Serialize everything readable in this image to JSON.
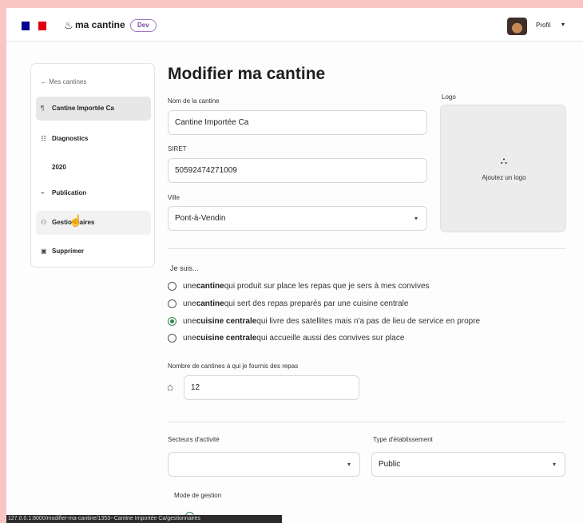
{
  "header": {
    "brand_name": "ma cantine",
    "brand_icon": "chef-hat-icon",
    "env_badge": "Dev",
    "profile_label": "Profil",
    "flag_colors": [
      "#000091",
      "#ffffff",
      "#e1000f"
    ]
  },
  "sidebar": {
    "back_label": "Mes cantines",
    "items": [
      {
        "label": "Cantine Importée Ca",
        "icon": "fork-knife-icon",
        "active": true
      },
      {
        "label": "Diagnostics",
        "icon": "list-icon"
      },
      {
        "label": "2020",
        "icon": ""
      },
      {
        "label": "Publication",
        "icon": "megaphone-icon"
      },
      {
        "label": "Gestionnaires",
        "icon": "team-icon"
      },
      {
        "label": "Supprimer",
        "icon": "trash-icon"
      }
    ]
  },
  "form": {
    "title": "Modifier ma cantine",
    "name_label": "Nom de la cantine",
    "name_value": "Cantine Importée Ca",
    "siret_label": "SIRET",
    "siret_value": "50592474271009",
    "city_label": "Ville",
    "city_value": "Pont-à-Vendin",
    "logo_label": "Logo",
    "logo_cta": "Ajoutez un logo",
    "role_label": "Je suis...",
    "role_options": [
      {
        "prefix": "une ",
        "bold": "cantine",
        "suffix": " qui produit sur place les repas que je sers à mes convives",
        "checked": false
      },
      {
        "prefix": "une ",
        "bold": "cantine",
        "suffix": " qui sert des repas preparés par une cuisine centrale",
        "checked": false
      },
      {
        "prefix": "une ",
        "bold": "cuisine centrale",
        "suffix": " qui livre des satellites mais n'a pas de lieu de service en propre",
        "checked": true
      },
      {
        "prefix": "une ",
        "bold": "cuisine centrale",
        "suffix": " qui accueille aussi des convives sur place",
        "checked": false
      }
    ],
    "satellite_count_label": "Nombre de cantines à qui je fournis des repas",
    "satellite_count_value": "12",
    "sectors_label": "Secteurs d'activité",
    "sectors_value": "",
    "establishment_type_label": "Type d'établissement",
    "establishment_type_value": "Public",
    "management_label": "Mode de gestion"
  },
  "status_bar": {
    "url": "127.0.0.1:8000/modifier-ma-cantine/1353--Cantine Importée Ca/gestionnaires"
  },
  "colors": {
    "accent_green": "#2f8a4e",
    "dev_badge": "#7b4aa6",
    "background_frame": "#f9c6c4"
  }
}
